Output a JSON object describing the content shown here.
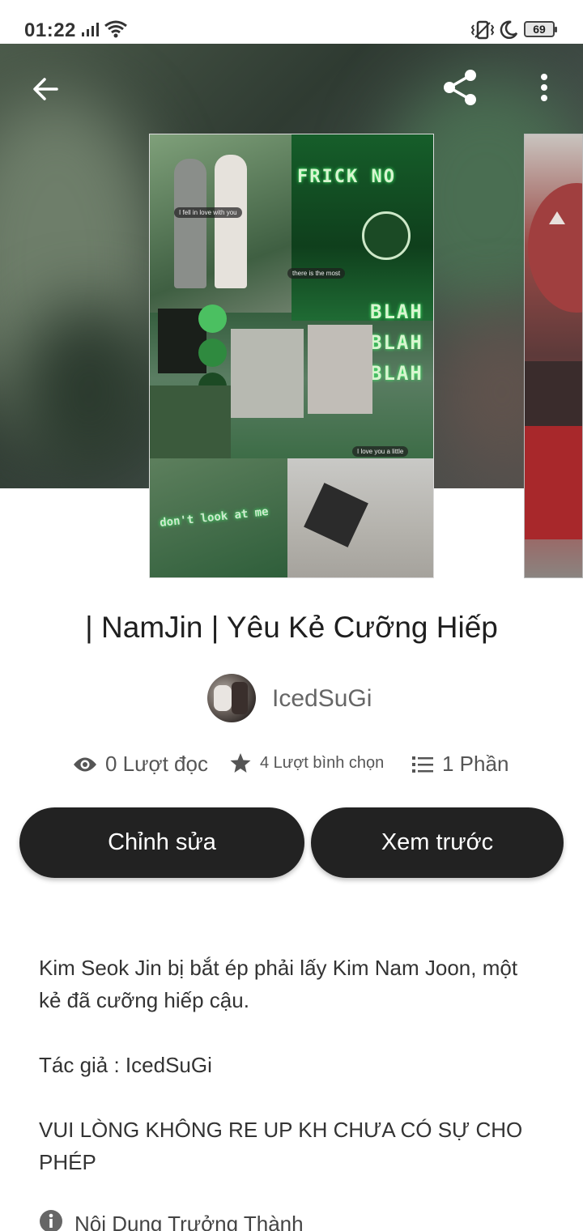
{
  "status_bar": {
    "time": "01:22",
    "battery": "69",
    "icons": [
      "signal-icon",
      "wifi-icon",
      "vibrate-icon",
      "moon-icon",
      "battery-icon"
    ]
  },
  "toolbar": {
    "back_icon": "arrow-left-icon",
    "share_icon": "share-icon",
    "more_icon": "more-vertical-icon"
  },
  "cover": {
    "text_frick": "FRICK NO",
    "text_blah": "BLAH",
    "text_dont": "don't look at me"
  },
  "story": {
    "title": "| NamJin | Yêu Kẻ Cưỡng Hiếp",
    "author": "IcedSuGi",
    "reads": "0 Lượt đọc",
    "votes": "4 Lượt bình chọn",
    "parts": "1 Phần"
  },
  "actions": {
    "edit_label": "Chỉnh sửa",
    "preview_label": "Xem trước"
  },
  "description": {
    "line1": "Kim Seok Jin bị bắt ép phải lấy Kim Nam Joon, một kẻ đã cưỡng hiếp cậu.",
    "line2": "Tác giả : IcedSuGi",
    "line3": "VUI LÒNG KHÔNG RE UP KH CHƯA CÓ SỰ CHO PHÉP"
  },
  "mature_label": "Nội Dung Trưởng Thành",
  "colors": {
    "button_bg": "#222222",
    "button_text": "#ffffff",
    "accent_green": "#3cff6a"
  }
}
